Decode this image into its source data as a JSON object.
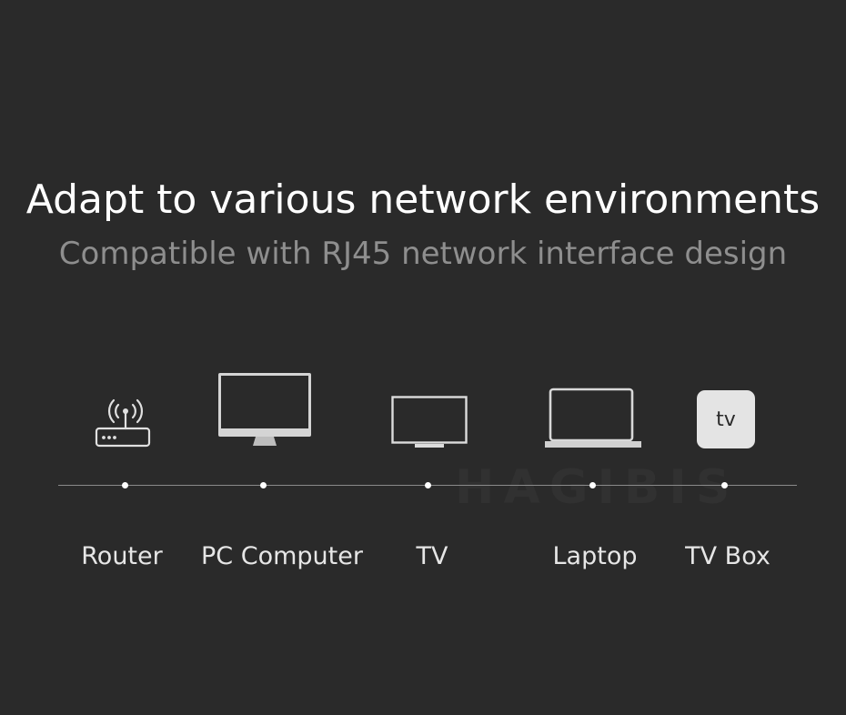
{
  "header": {
    "title": "Adapt to various network environments",
    "subtitle": "Compatible with RJ45 network interface design"
  },
  "watermark": "HAGIBIS",
  "devices": [
    {
      "label": "Router",
      "icon": "router-icon"
    },
    {
      "label": "PC Computer",
      "icon": "monitor-icon"
    },
    {
      "label": "TV",
      "icon": "tv-icon"
    },
    {
      "label": "Laptop",
      "icon": "laptop-icon"
    },
    {
      "label": "TV Box",
      "icon": "tv-box-icon",
      "icon_text": "tv"
    }
  ],
  "colors": {
    "background": "#2a2a2a",
    "title": "#ffffff",
    "subtitle": "#8e8e8e",
    "line": "#8a8a8a",
    "icon": "#e0e0e0"
  }
}
